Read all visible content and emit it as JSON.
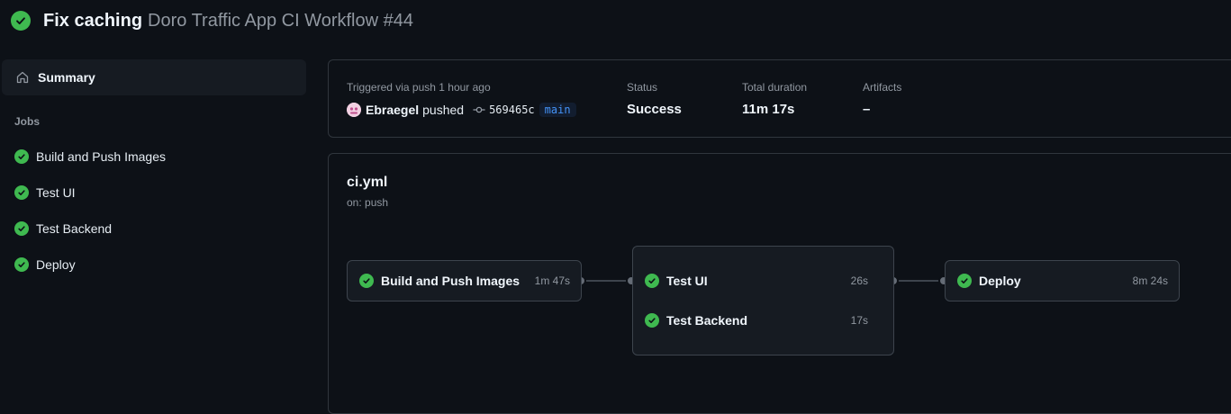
{
  "header": {
    "title": "Fix caching",
    "subtitle": "Doro Traffic App CI Workflow #44",
    "status_icon": "check-circle-icon"
  },
  "sidebar": {
    "summary_label": "Summary",
    "jobs_heading": "Jobs",
    "jobs": [
      {
        "label": "Build and Push Images",
        "icon": "check-circle-icon"
      },
      {
        "label": "Test UI",
        "icon": "check-circle-icon"
      },
      {
        "label": "Test Backend",
        "icon": "check-circle-icon"
      },
      {
        "label": "Deploy",
        "icon": "check-circle-icon"
      }
    ]
  },
  "run_summary": {
    "trigger_label": "Triggered via push 1 hour ago",
    "author": "Ebraegel",
    "action": "pushed",
    "commit_sha": "569465c",
    "branch": "main",
    "status_label": "Status",
    "status_value": "Success",
    "duration_label": "Total duration",
    "duration_value": "11m 17s",
    "artifacts_label": "Artifacts",
    "artifacts_value": "–"
  },
  "workflow": {
    "file": "ci.yml",
    "trigger": "on: push",
    "jobs": [
      {
        "name": "Build and Push Images",
        "duration": "1m 47s"
      },
      {
        "name": "Test UI",
        "duration": "26s"
      },
      {
        "name": "Test Backend",
        "duration": "17s"
      },
      {
        "name": "Deploy",
        "duration": "8m 24s"
      }
    ]
  },
  "colors": {
    "background": "#0d1117",
    "success": "#3fb950",
    "branch": "#4493f8",
    "muted": "#9198a1"
  }
}
